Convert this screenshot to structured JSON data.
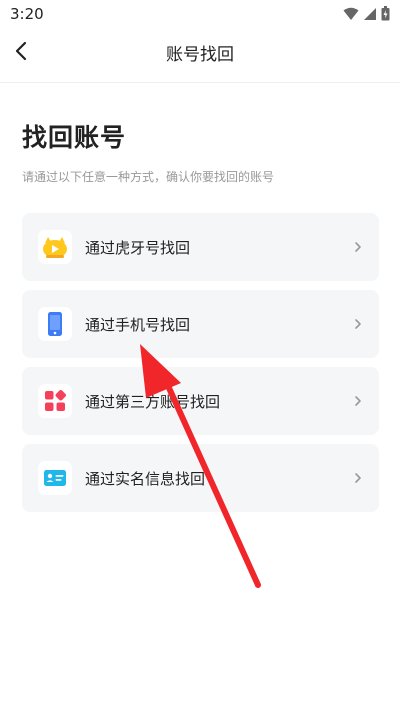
{
  "status_bar": {
    "time": "3:20"
  },
  "nav": {
    "title": "账号找回"
  },
  "page": {
    "title": "找回账号",
    "subtitle": "请通过以下任意一种方式，确认你要找回的账号"
  },
  "options": [
    {
      "label": "通过虎牙号找回",
      "icon": "huya-mascot-icon"
    },
    {
      "label": "通过手机号找回",
      "icon": "phone-icon"
    },
    {
      "label": "通过第三方账号找回",
      "icon": "apps-icon"
    },
    {
      "label": "通过实名信息找回",
      "icon": "id-card-icon"
    }
  ],
  "colors": {
    "card_bg": "#f5f6f7",
    "subtitle": "#999999",
    "annotation_arrow": "#f0262b",
    "icon_yellow": "#ffc81e",
    "icon_blue": "#3d7cf5",
    "icon_pink": "#f5405a",
    "icon_cyan": "#1fb8e8"
  }
}
